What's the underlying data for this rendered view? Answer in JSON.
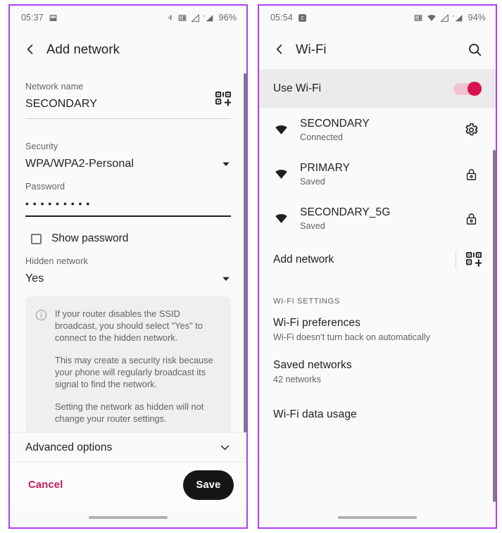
{
  "left_phone": {
    "status_bar": {
      "time": "05:37",
      "left_icon": "image-icon",
      "icons": [
        "bluetooth-icon",
        "vpn-key-icon",
        "signal-sim1-icon",
        "signal-sim2-icon"
      ],
      "battery": "96%"
    },
    "appbar": {
      "back_icon": "back-chevron-icon",
      "title": "Add network"
    },
    "form": {
      "network_name": {
        "label": "Network name",
        "value": "SECONDARY",
        "qr_icon": "qr-scan-icon"
      },
      "security": {
        "label": "Security",
        "value": "WPA/WPA2-Personal",
        "caret_icon": "chevron-down-icon"
      },
      "password": {
        "label": "Password",
        "value": "• • • • • • • • •"
      },
      "show_password": {
        "label": "Show password",
        "checked": false
      },
      "hidden_network": {
        "label": "Hidden network",
        "value": "Yes",
        "caret_icon": "chevron-down-icon"
      }
    },
    "info_box": {
      "icon": "info-circle-icon",
      "paragraphs": [
        "If your router disables the SSID broadcast, you should select \"Yes\" to connect to the hidden network.",
        "This may create a security risk because your phone will regularly broadcast its signal to find the network.",
        "Setting the network as hidden will not change your router settings."
      ]
    },
    "advanced": {
      "label": "Advanced options",
      "caret_icon": "chevron-down-icon"
    },
    "actions": {
      "cancel_label": "Cancel",
      "save_label": "Save"
    }
  },
  "right_phone": {
    "status_bar": {
      "time": "05:54",
      "left_icon": "sigma-badge-icon",
      "icons": [
        "vpn-key-icon",
        "wifi-icon",
        "signal-sim1-icon",
        "signal-sim2-icon"
      ],
      "battery": "94%"
    },
    "appbar": {
      "back_icon": "back-chevron-icon",
      "title": "Wi-Fi",
      "search_icon": "search-icon"
    },
    "use_wifi": {
      "label": "Use Wi-Fi",
      "enabled": true
    },
    "networks": [
      {
        "name": "SECONDARY",
        "status": "Connected",
        "wifi_icon": "wifi-full-icon",
        "trailing_icon": "gear-icon"
      },
      {
        "name": "PRIMARY",
        "status": "Saved",
        "wifi_icon": "wifi-full-icon",
        "trailing_icon": "lock-icon"
      },
      {
        "name": "SECONDARY_5G",
        "status": "Saved",
        "wifi_icon": "wifi-full-icon",
        "trailing_icon": "lock-icon"
      }
    ],
    "add_network": {
      "label": "Add network",
      "qr_icon": "qr-scan-icon"
    },
    "settings_section": {
      "header": "WI-FI SETTINGS",
      "items": [
        {
          "title": "Wi-Fi preferences",
          "subtitle": "Wi-Fi doesn't turn back on automatically"
        },
        {
          "title": "Saved networks",
          "subtitle": "42 networks"
        },
        {
          "title": "Wi-Fi data usage",
          "subtitle": ""
        }
      ]
    }
  },
  "colors": {
    "frame_border": "#b43df5",
    "accent_pink": "#c2185b",
    "toggle_on": "#d5134f",
    "toggle_track": "#f0c3d1",
    "save_button": "#161616"
  }
}
